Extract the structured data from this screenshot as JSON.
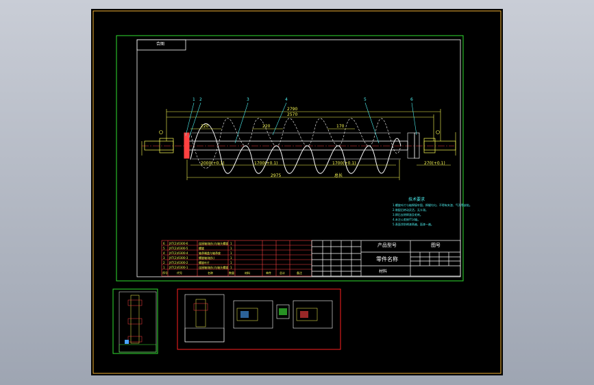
{
  "colors": {
    "background": "#000000",
    "outer_frame": "#f2b233",
    "drawing_frame": "#30e030",
    "title_block": "#ffffff",
    "dimension": "#ffff55",
    "screw": "#ffffff",
    "leader": "#4ef2f2",
    "bom_lines": "#ff4141",
    "preview_frame": "#ff2020"
  },
  "drawing": {
    "corner_tag": "合图",
    "balloons": [
      "1",
      "2",
      "3",
      "4",
      "5",
      "6"
    ],
    "dims": {
      "overall_top": "2790",
      "overall_second": "2570",
      "pitch_1": "220",
      "pitch_2": "220",
      "pitch_3": "170",
      "seg_1": "2000(+0.1)",
      "seg_2": "1700(+0.1)",
      "seg_3": "1700(+0.1)",
      "seg_4": "270(+0.1)",
      "bottom_total": "2975",
      "bottom_mid": "总长"
    }
  },
  "tech_notes": {
    "title": "技术要求",
    "lines": [
      "1.螺旋叶片与轴焊接牢固，焊缝均匀，不得有夹渣、气孔等缺陷。",
      "2.装配后转动灵活，无卡滞。",
      "3.焊后去除焊渣及毛刺。",
      "4.未注公差按IT14级。",
      "5.表面涂防锈漆两遍，面漆一遍。"
    ]
  },
  "bom": {
    "rows": [
      [
        "6",
        "JXT(2)/0300-6",
        "连接轴(轴头)与轴头螺旋",
        "1"
      ],
      [
        "5",
        "JXT(2)/0300-5",
        "螺旋",
        "1"
      ],
      [
        "4",
        "JXT(2)/0300-4",
        "轴承端盖与轴承座",
        "1"
      ],
      [
        "3",
        "JXT(2)/0300-3",
        "螺旋轴(轴头)",
        "1"
      ],
      [
        "2",
        "JXT(2)/0300-2",
        "螺旋叶片",
        "1"
      ],
      [
        "1",
        "JXT(2)/0300-1",
        "连接轴(轴头)与轴头螺旋",
        "1"
      ]
    ],
    "header": [
      "序号",
      "代号",
      "名称",
      "数量",
      "材料",
      "单件",
      "总计",
      "备注"
    ]
  },
  "title_block": {
    "product_label": "产品型号",
    "drawing_no_label": "图号",
    "part_name_label": "零件名称",
    "material_label": "材料"
  }
}
